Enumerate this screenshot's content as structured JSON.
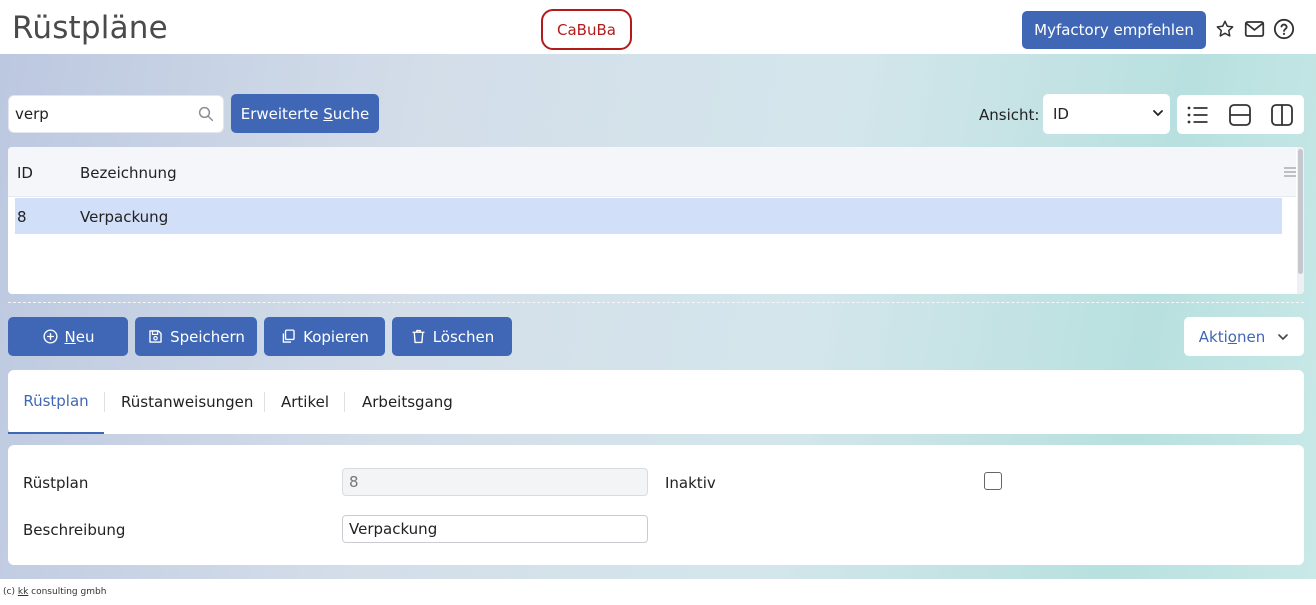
{
  "header": {
    "title": "Rüstpläne",
    "tenant": "CaBuBa",
    "recommend_label": "Myfactory empfehlen",
    "icons": [
      "star-icon",
      "mail-icon",
      "help-icon"
    ]
  },
  "search": {
    "value": "verp",
    "extended_label_pre": "Erweiterte ",
    "extended_label_key": "S",
    "extended_label_post": "uche"
  },
  "view": {
    "label": "Ansicht:",
    "selected": "ID",
    "modes": [
      "list-view-icon",
      "split-horizontal-icon",
      "split-vertical-icon"
    ]
  },
  "grid": {
    "columns": [
      "ID",
      "Bezeichnung"
    ],
    "rows": [
      {
        "id": "8",
        "name": "Verpackung",
        "selected": true
      }
    ]
  },
  "actions": {
    "new_key": "N",
    "new_rest": "eu",
    "save_label": "Speichern",
    "copy_label": "Kopieren",
    "delete_label": "Löschen",
    "more_pre": "Akti",
    "more_key": "o",
    "more_post": "nen"
  },
  "tabs": [
    "Rüstplan",
    "Rüstanweisungen",
    "Artikel",
    "Arbeitsgang"
  ],
  "form": {
    "plan_label": "Rüstplan",
    "plan_value": "8",
    "inactive_label": "Inaktiv",
    "inactive_checked": false,
    "desc_label": "Beschreibung",
    "desc_value": "Verpackung"
  },
  "footer": {
    "pre": "(c) ",
    "k1": "k",
    "k2": "k",
    "post": " consulting gmbh"
  },
  "colors": {
    "primary": "#3f67b5",
    "tenant_border": "#b31b1b",
    "selected_row": "#d1dff8"
  }
}
